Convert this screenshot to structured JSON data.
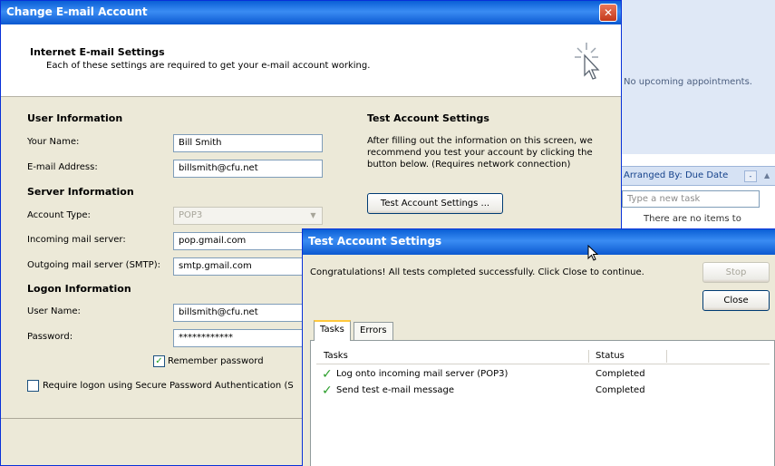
{
  "background": {
    "no_appointments": "No upcoming appointments.",
    "arranged_by": "Arranged By: Due Date",
    "arranged_toggle": "-",
    "new_task_placeholder": "Type a new task",
    "no_items_partial": "There are no items to"
  },
  "dialog": {
    "title": "Change E-mail Account",
    "close_glyph": "✕",
    "header_title": "Internet E-mail Settings",
    "header_subtitle": "Each of these settings are required to get your e-mail account working."
  },
  "user_info": {
    "heading": "User Information",
    "name_label": "Your Name:",
    "name_value": "Bill Smith",
    "email_label": "E-mail Address:",
    "email_value": "billsmith@cfu.net"
  },
  "server_info": {
    "heading": "Server Information",
    "account_type_label": "Account Type:",
    "account_type_value": "POP3",
    "incoming_label": "Incoming mail server:",
    "incoming_value": "pop.gmail.com",
    "outgoing_label": "Outgoing mail server (SMTP):",
    "outgoing_value": "smtp.gmail.com"
  },
  "logon_info": {
    "heading": "Logon Information",
    "username_label": "User Name:",
    "username_value": "billsmith@cfu.net",
    "password_label": "Password:",
    "password_value": "************",
    "remember_label": "Remember password",
    "remember_checked": true,
    "spa_label": "Require logon using Secure Password Authentication (S",
    "spa_checked": false
  },
  "test_settings": {
    "heading": "Test Account Settings",
    "description": "After filling out the information on this screen, we recommend you test your account by clicking the button below. (Requires network connection)",
    "button_label": "Test Account Settings ..."
  },
  "test_dialog": {
    "title": "Test Account Settings",
    "message": "Congratulations! All tests completed successfully. Click Close to continue.",
    "stop_label": "Stop",
    "close_label": "Close",
    "tabs": [
      {
        "label": "Tasks",
        "active": true
      },
      {
        "label": "Errors",
        "active": false
      }
    ],
    "columns": {
      "tasks": "Tasks",
      "status": "Status"
    },
    "rows": [
      {
        "task": "Log onto incoming mail server (POP3)",
        "status": "Completed"
      },
      {
        "task": "Send test e-mail message",
        "status": "Completed"
      }
    ]
  }
}
